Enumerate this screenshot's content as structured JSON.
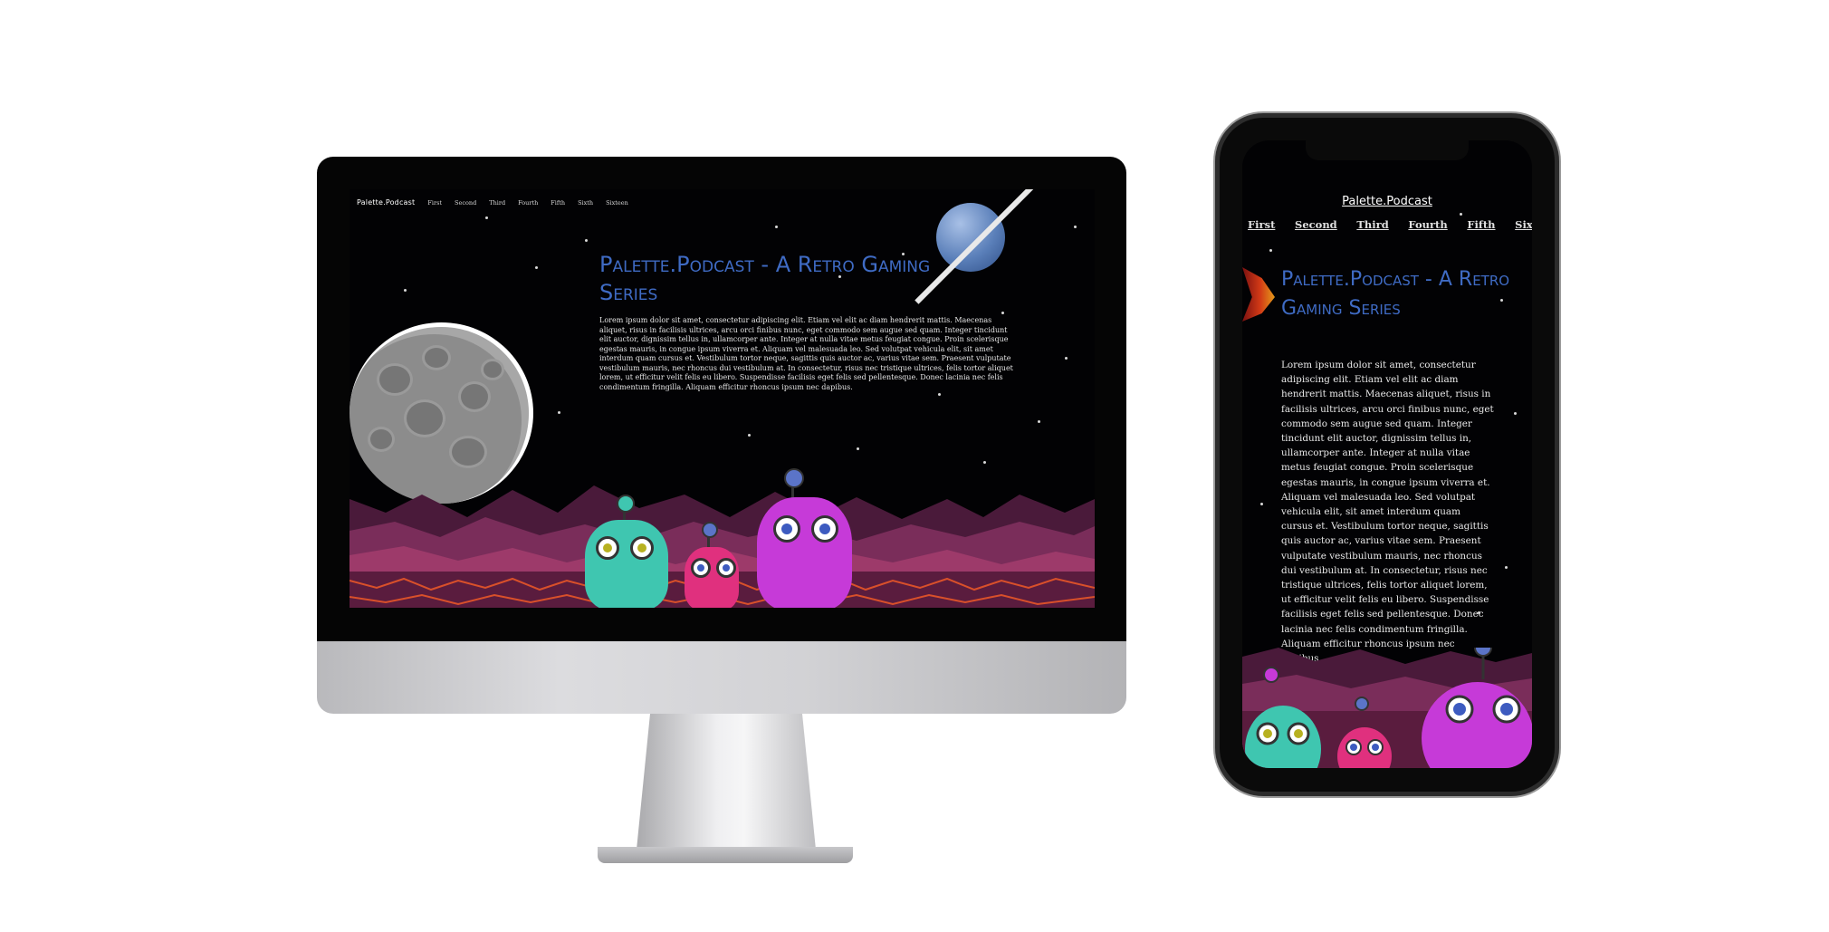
{
  "site": {
    "brand": "Palette.Podcast",
    "nav": [
      "First",
      "Second",
      "Third",
      "Fourth",
      "Fifth",
      "Sixth",
      "Sixteen"
    ],
    "title": "Palette.Podcast - A Retro Gaming Series",
    "body": "Lorem ipsum dolor sit amet, consectetur adipiscing elit. Etiam vel elit ac diam hendrerit mattis. Maecenas aliquet, risus in facilisis ultrices, arcu orci finibus nunc, eget commodo sem augue sed quam. Integer tincidunt elit auctor, dignissim tellus in, ullamcorper ante. Integer at nulla vitae metus feugiat congue. Proin scelerisque egestas mauris, in congue ipsum viverra et. Aliquam vel malesuada leo. Sed volutpat vehicula elit, sit amet interdum quam cursus et. Vestibulum tortor neque, sagittis quis auctor ac, varius vitae sem. Praesent vulputate vestibulum mauris, nec rhoncus dui vestibulum at. In consectetur, risus nec tristique ultrices, felis tortor aliquet lorem, ut efficitur velit felis eu libero. Suspendisse facilisis eget felis sed pellentesque. Donec lacinia nec felis condimentum fringilla. Aliquam efficitur rhoncus ipsum nec dapibus."
  },
  "phone": {
    "nav": [
      "First",
      "Second",
      "Third",
      "Fourth",
      "Fifth",
      "Sixt"
    ]
  },
  "colors": {
    "title": "#3f6bc4",
    "background": "#020204",
    "alien_teal": "#3fc6b0",
    "alien_pink": "#e0307e",
    "alien_magenta": "#c63ad8",
    "mountains": "#7a2d5a"
  }
}
